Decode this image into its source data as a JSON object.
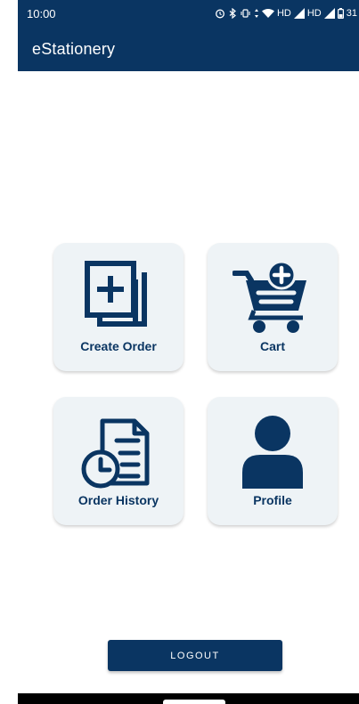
{
  "status_bar": {
    "time": "10:00",
    "network_1": "HD",
    "network_2": "HD",
    "battery": "31"
  },
  "app_bar": {
    "title": "eStationery"
  },
  "tiles": [
    {
      "label": "Create Order",
      "icon": "create-order-icon"
    },
    {
      "label": "Cart",
      "icon": "cart-add-icon"
    },
    {
      "label": "Order History",
      "icon": "order-history-icon"
    },
    {
      "label": "Profile",
      "icon": "profile-icon"
    }
  ],
  "logout_label": "LOGOUT",
  "colors": {
    "primary": "#0a3562",
    "tile_bg": "#eef3f6",
    "background": "#ffffff"
  }
}
